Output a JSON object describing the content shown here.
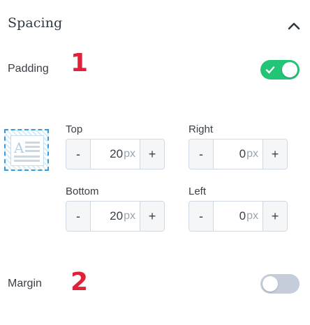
{
  "section": {
    "title": "Spacing",
    "collapse_icon": "chevron-up-icon"
  },
  "padding": {
    "label": "Padding",
    "annotation": "1",
    "enabled": true,
    "toggle_color": "#22c476",
    "icon": "padding-box-icon",
    "fields": {
      "top": {
        "label": "Top",
        "value": "20",
        "unit": "px",
        "minus": "-",
        "plus": "+"
      },
      "right": {
        "label": "Right",
        "value": "0",
        "unit": "px",
        "minus": "-",
        "plus": "+"
      },
      "bottom": {
        "label": "Bottom",
        "value": "20",
        "unit": "px",
        "minus": "-",
        "plus": "+"
      },
      "left": {
        "label": "Left",
        "value": "0",
        "unit": "px",
        "minus": "-",
        "plus": "+"
      }
    }
  },
  "margin": {
    "label": "Margin",
    "annotation": "2",
    "enabled": false,
    "toggle_color": "#c4cdd9"
  },
  "annotation_color": "#e1203a"
}
